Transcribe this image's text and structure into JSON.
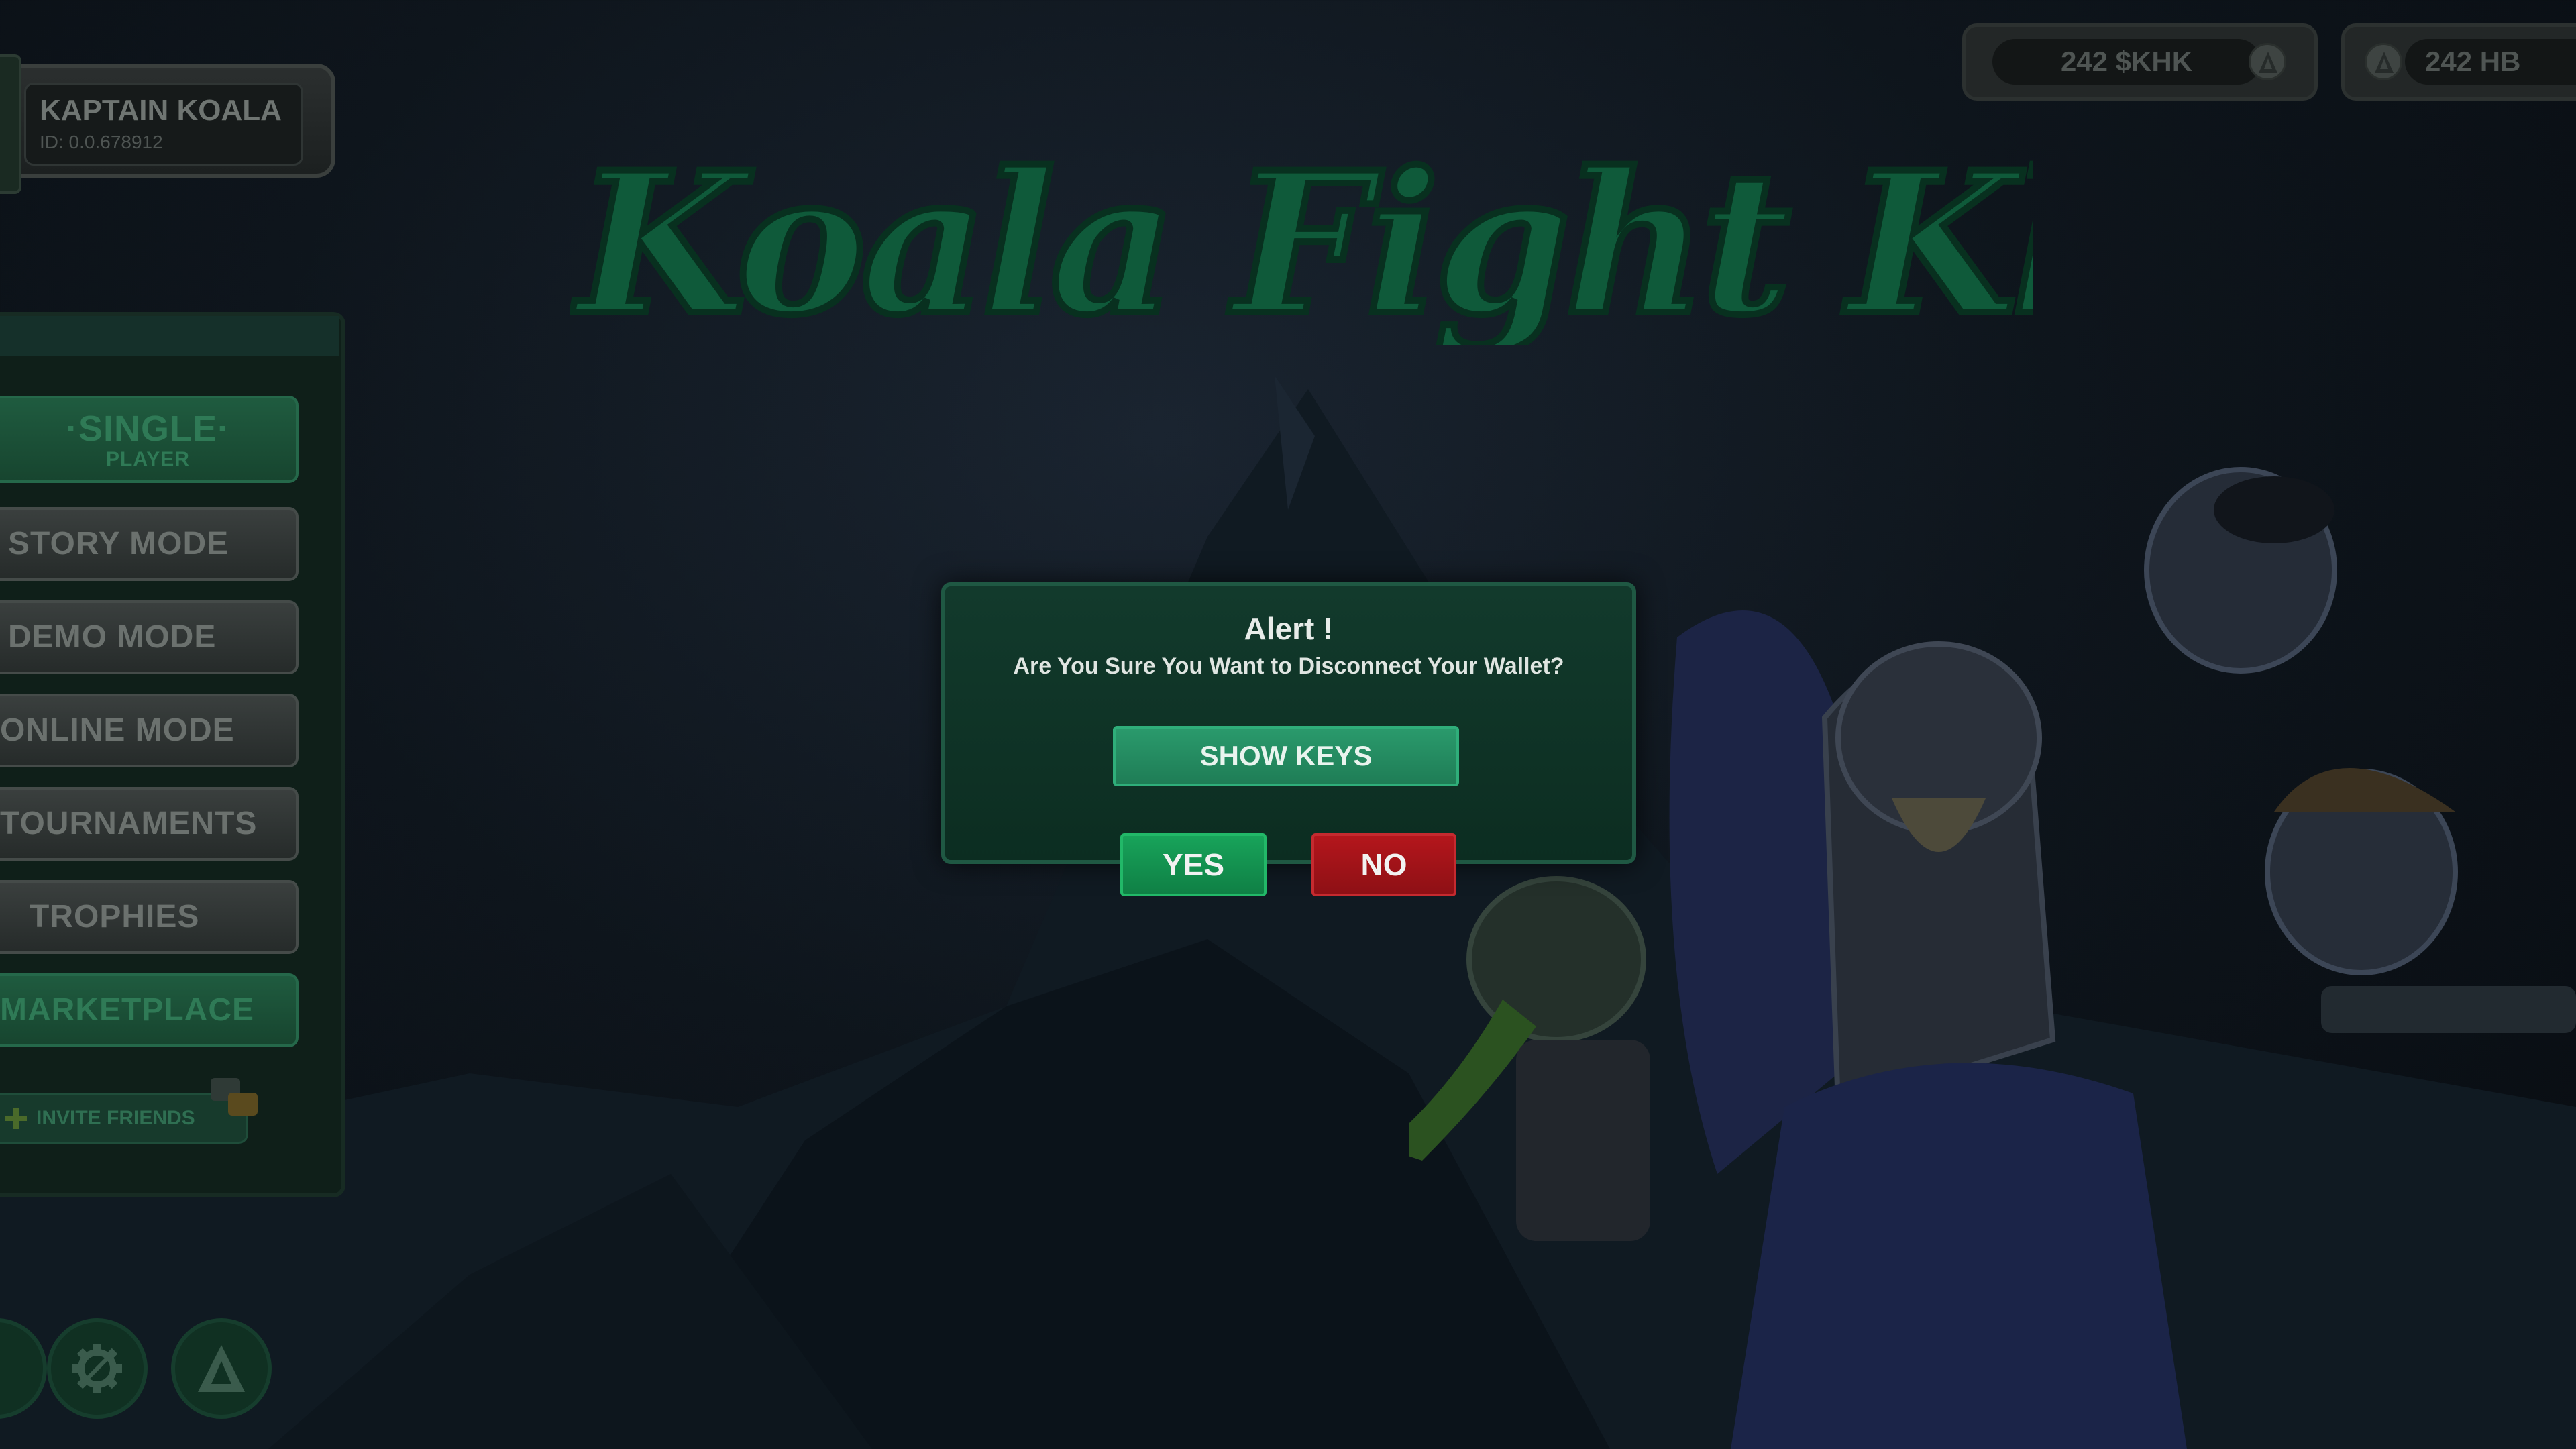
{
  "game": {
    "logo_text": "Koala Fight Klub"
  },
  "profile": {
    "name": "KAPTAIN KOALA",
    "id": "ID: 0.0.678912"
  },
  "currencies": [
    {
      "label": "242 $KHK",
      "icon": "hbar-icon"
    },
    {
      "label": "242 HB",
      "icon": "hbar-icon"
    }
  ],
  "menu": {
    "single_player_main": "·SINGLE·",
    "single_player_sub": "PLAYER",
    "items": [
      {
        "label": "STORY MODE"
      },
      {
        "label": "DEMO MODE"
      },
      {
        "label": "ONLINE MODE"
      },
      {
        "label": "TOURNAMENTS"
      },
      {
        "label": "TROPHIES"
      },
      {
        "label": "MARKETPLACE"
      }
    ],
    "invite_label": "INVITE FRIENDS"
  },
  "bottom_icons": [
    "settings-gear-icon",
    "hbar-icon"
  ],
  "alert": {
    "title": "Alert !",
    "message": "Are You Sure You Want to Disconnect Your Wallet?",
    "show_keys_label": "SHOW KEYS",
    "yes_label": "YES",
    "no_label": "NO"
  },
  "colors": {
    "modal_bg": "#0c2d21",
    "show_keys": "#1f7d56",
    "yes": "#0f8045",
    "no": "#8e1015"
  }
}
